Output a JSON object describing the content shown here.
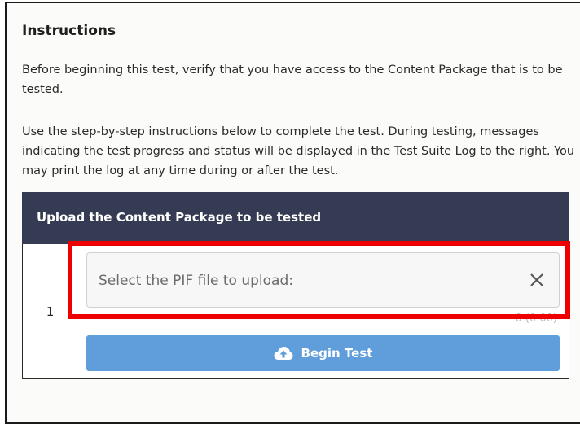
{
  "instructions": {
    "title": "Instructions",
    "paragraph_1": "Before beginning this test, verify that you have access to the Content Package that is to be tested.",
    "paragraph_2": "Use the step-by-step instructions below to complete the test. During testing, messages indicating the test progress and status will be displayed in the Test Suite Log to the right. You may print the log at any time during or after the test."
  },
  "upload_section": {
    "header": "Upload the Content Package to be tested",
    "step_number": "1",
    "file_input": {
      "placeholder": "Select the PIF file to upload:",
      "clear_icon": "close-icon",
      "status": "0 (0.00)"
    },
    "begin_button": {
      "label": "Begin Test",
      "icon": "cloud-upload-icon"
    }
  },
  "colors": {
    "header_background": "#353b52",
    "button_background": "#5f9edb",
    "highlight": "#ee0000"
  }
}
